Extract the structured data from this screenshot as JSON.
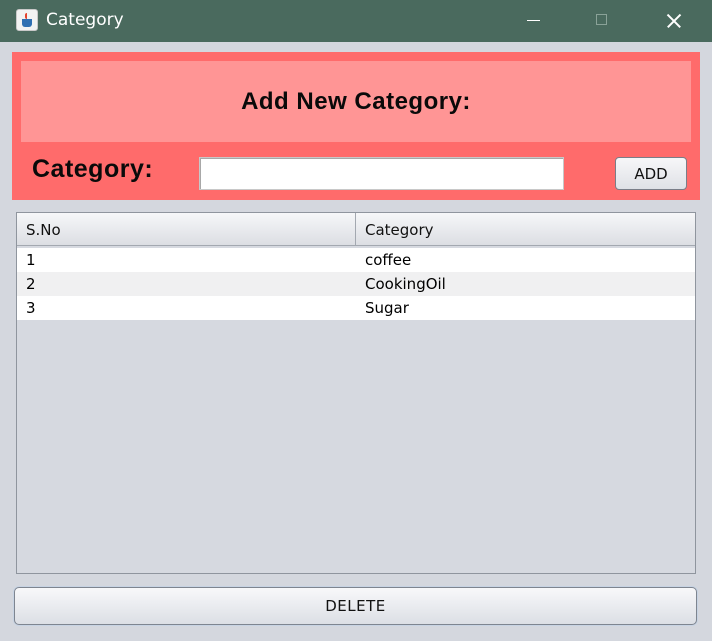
{
  "window": {
    "title": "Category",
    "icon": "java-cup-icon"
  },
  "form": {
    "heading": "Add New Category:",
    "category_label": "Category:",
    "category_value": "",
    "add_label": "ADD"
  },
  "table": {
    "columns": [
      "S.No",
      "Category"
    ],
    "rows": [
      [
        "1",
        "coffee"
      ],
      [
        "2",
        "CookingOil"
      ],
      [
        "3",
        "Sugar"
      ]
    ]
  },
  "actions": {
    "delete_label": "DELETE"
  },
  "colors": {
    "titlebar": "#4a6a5e",
    "panel": "#ff6b6b",
    "header_box": "#ff9595",
    "table_bg": "#d6d9e0"
  }
}
